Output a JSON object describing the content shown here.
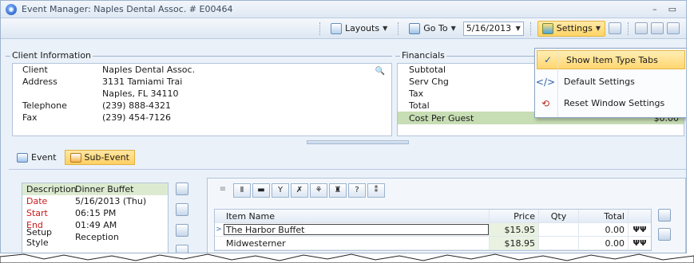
{
  "window": {
    "title": "Event Manager:  Naples Dental Assoc. # E00464",
    "controls": [
      "–",
      "▭"
    ]
  },
  "toolbar": {
    "layouts_label": "Layouts",
    "goto_label": "Go To",
    "date_value": "5/16/2013",
    "settings_label": "Settings"
  },
  "client": {
    "section_label": "Client Information",
    "rows": [
      {
        "key": "Client",
        "value": "Naples Dental Assoc."
      },
      {
        "key": "Address",
        "value": "3131 Tamiami Trai"
      },
      {
        "key": "",
        "value": "Naples, FL 34110"
      },
      {
        "key": "Telephone",
        "value": "(239) 888-4321"
      },
      {
        "key": "Fax",
        "value": "(239) 454-7126"
      }
    ]
  },
  "financials": {
    "section_label": "Financials",
    "rows": [
      {
        "key": "Subtotal",
        "value": ""
      },
      {
        "key": "Serv Chg",
        "value": ""
      },
      {
        "key": "Tax",
        "value": ""
      },
      {
        "key": "Total",
        "value": ""
      }
    ],
    "cost_per_guest_label": "Cost Per Guest",
    "cost_per_guest_value": "$0.00"
  },
  "settings_menu": {
    "items": [
      {
        "label": "Show Item Type Tabs",
        "icon": "check-icon"
      },
      {
        "label": "Default Settings",
        "icon": "default-settings-icon"
      },
      {
        "label": "Reset Window Settings",
        "icon": "reset-icon"
      }
    ]
  },
  "tabs": {
    "event": "Event",
    "sub_event": "Sub-Event"
  },
  "description": {
    "rows": [
      {
        "key": "Description",
        "value": "Dinner Buffet",
        "red": false
      },
      {
        "key": "Date",
        "value": "5/16/2013 (Thu)",
        "red": true
      },
      {
        "key": "Start",
        "value": "06:15 PM",
        "red": true
      },
      {
        "key": "End",
        "value": "01:49 AM",
        "red": true
      },
      {
        "key": "Setup Style",
        "value": "Reception",
        "red": false
      }
    ]
  },
  "item_type_tabs": [
    "Ⅱ",
    "▬",
    "Y",
    "✗",
    "⚘",
    "♜",
    "?",
    "⁑"
  ],
  "grid": {
    "headers": {
      "name": "Item Name",
      "price": "Price",
      "qty": "Qty",
      "total": "Total"
    },
    "rows": [
      {
        "name": "The Harbor Buffet",
        "price": "$15.95",
        "qty": "",
        "total": "0.00",
        "icon": "ĨĨ"
      },
      {
        "name": "Midwesterner",
        "price": "$18.95",
        "qty": "",
        "total": "0.00",
        "icon": "ĨĨ"
      }
    ]
  },
  "colors": {
    "accent": "#ffd466",
    "cost_per_guest_bg": "#c7ddb4",
    "required_label": "#cc1a1a"
  }
}
